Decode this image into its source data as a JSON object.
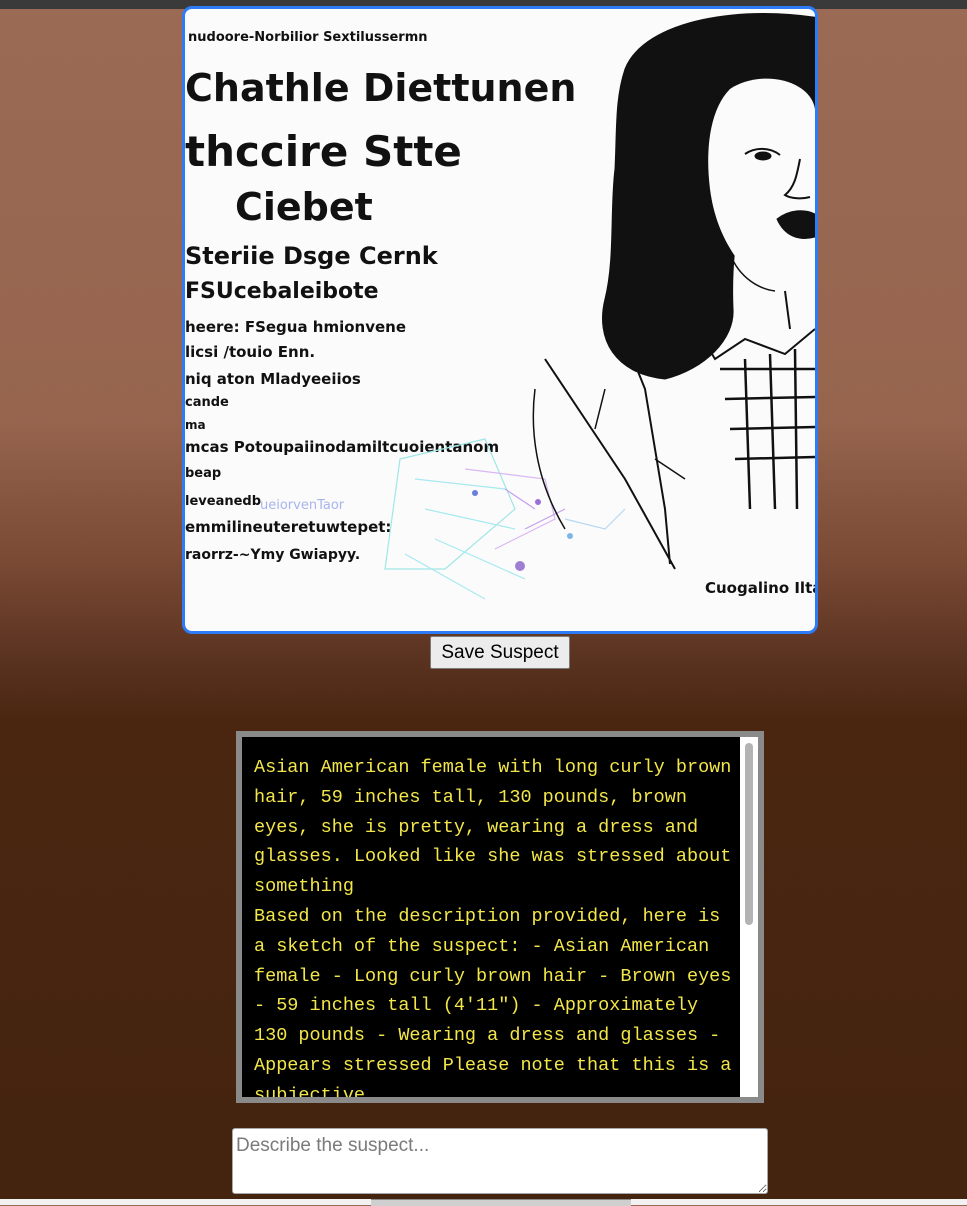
{
  "sketch": {
    "header_line": "nudoore-Norbilior Sextilussermn",
    "title_line_1": "Chathle Diettunen",
    "title_line_2": "thccire Stte",
    "title_line_3": "Ciebet",
    "subtitle_1": "Steriie Dsge Cernk",
    "subtitle_2": "FSUcebaleibote",
    "lines": [
      "heere: FSegua hmionvene",
      "licsi /touio Enn.",
      "niq aton Mladyeeiios",
      "cande",
      "ma",
      "mcas Potoupaiinodamiltcuoientanom",
      "beap",
      "leveanedb",
      "emmilineuteretuwtepet:",
      "raorrz-~Ymy Gwiapyy."
    ],
    "faint_line": "ueiorvenTaor",
    "signature": "Cuogalino Ilta"
  },
  "save_button_label": "Save Suspect",
  "log": {
    "user_message": "Asian American female with long curly brown hair, 59 inches tall, 130 pounds, brown eyes, she is pretty, wearing a dress and glasses. Looked like she was stressed about something",
    "assistant_message": "Based on the description provided, here is a sketch of the suspect: - Asian American female - Long curly brown hair - Brown eyes - 59 inches tall (4'11\") - Approximately 130 pounds - Wearing a dress and glasses - Appears stressed Please note that this is a subjective"
  },
  "describe_input": {
    "placeholder": "Describe the suspect...",
    "value": ""
  },
  "colors": {
    "image_border": "#2d7cf6",
    "log_text": "#f2e64a",
    "log_background": "#000000",
    "log_border": "#8a8a8a"
  }
}
